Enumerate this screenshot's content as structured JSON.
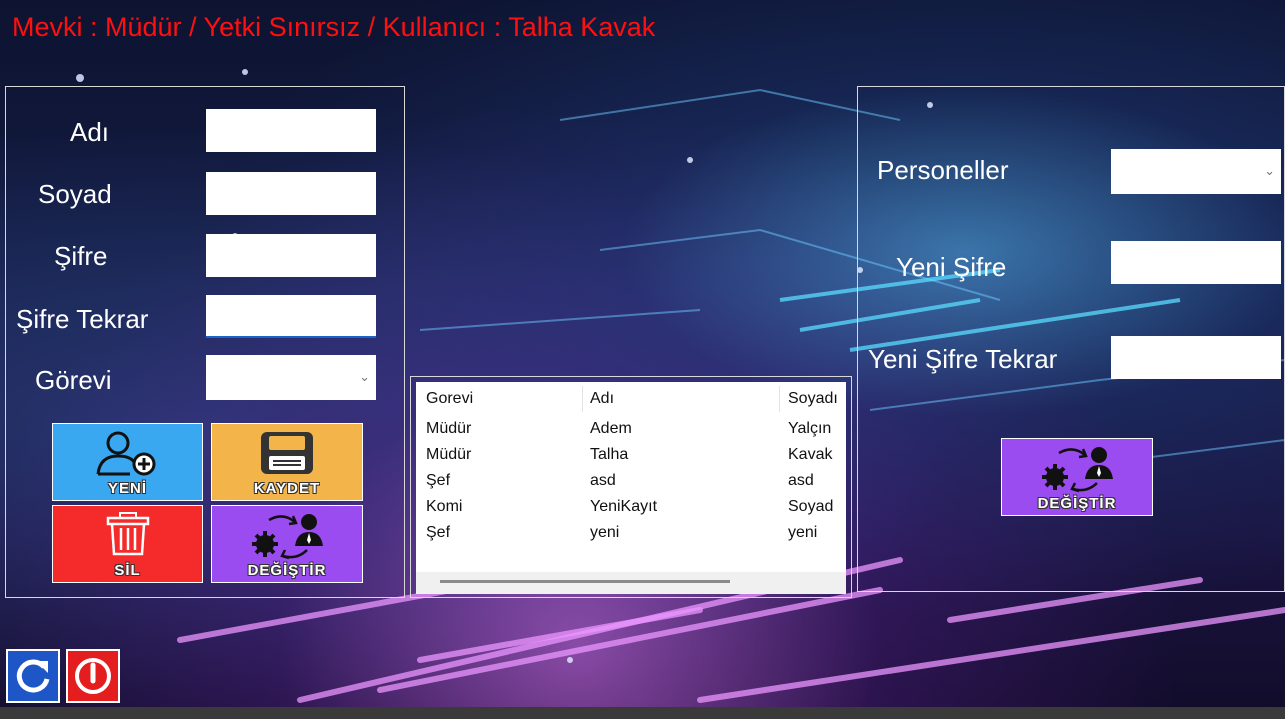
{
  "header": {
    "title": "Mevki : Müdür / Yetki Sınırsız / Kullanıcı : Talha Kavak"
  },
  "form": {
    "ad_label": "Adı",
    "soyad_label": "Soyad",
    "sifre_label": "Şifre",
    "sifre_tekrar_label": "Şifre Tekrar",
    "gorevi_label": "Görevi",
    "ad_value": "",
    "soyad_value": "",
    "sifre_value": "",
    "sifre_tekrar_value": "",
    "gorevi_value": ""
  },
  "actions": {
    "yeni": "YENİ",
    "kaydet": "KAYDET",
    "sil": "SİL",
    "degistir": "DEĞİŞTİR"
  },
  "table": {
    "columns": [
      "Gorevi",
      "Adı",
      "Soyadı"
    ],
    "rows": [
      [
        "Müdür",
        "Adem",
        "Yalçın"
      ],
      [
        "Müdür",
        "Talha",
        "Kavak"
      ],
      [
        "Şef",
        "asd",
        "asd"
      ],
      [
        "Komi",
        "YeniKayıt",
        "Soyad"
      ],
      [
        "Şef",
        "yeni",
        "yeni"
      ]
    ]
  },
  "password_change": {
    "personeller_label": "Personeller",
    "yeni_sifre_label": "Yeni Şifre",
    "yeni_sifre_tekrar_label": "Yeni Şifre Tekrar",
    "personeller_value": "",
    "yeni_sifre_value": "",
    "yeni_sifre_tekrar_value": "",
    "button_label": "DEĞİŞTİR"
  },
  "colors": {
    "title": "#ff1010",
    "yeni_tile": "#3aa8f0",
    "kaydet_tile": "#f3b44a",
    "sil_tile": "#f52a2a",
    "degistir_tile": "#9a4cf0",
    "refresh_button": "#1e56c8",
    "power_button": "#e41e1e"
  },
  "icons": {
    "yeni": "add-user-icon",
    "kaydet": "floppy-disk-icon",
    "sil": "trash-icon",
    "degistir": "user-swap-gear-icon",
    "refresh": "refresh-icon",
    "power": "power-icon"
  }
}
